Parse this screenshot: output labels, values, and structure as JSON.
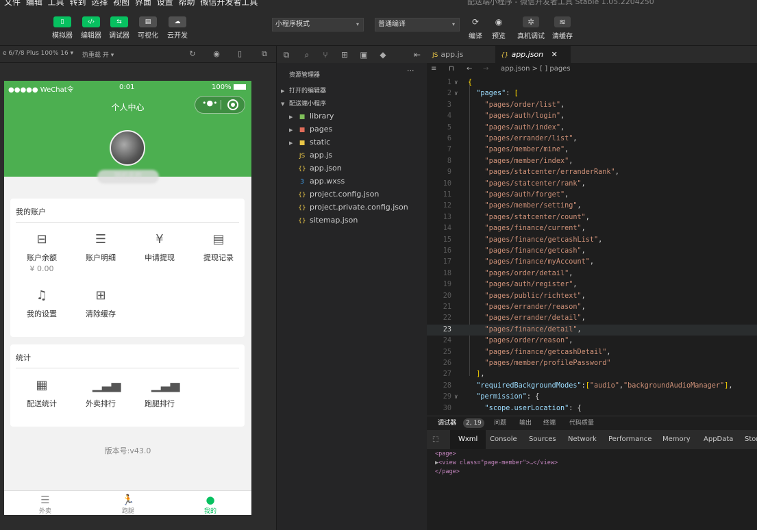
{
  "menubar": {
    "items": "文件 编辑 工具 转到 选择 视图 界面 设置 帮助 微信开发者工具",
    "window_title": "配送端小程序 - 微信开发者工具 Stable 1.05.2204250"
  },
  "toolbar": {
    "simulator": "模拟器",
    "editor": "编辑器",
    "debugger": "调试器",
    "visual": "可视化",
    "cloud": "云开发",
    "mode_select": "小程序模式",
    "compile_select": "普通编译",
    "compile": "编译",
    "preview": "预览",
    "real_debug": "真机调试",
    "clear_cache": "清缓存"
  },
  "simbar": {
    "device": "e 6/7/8 Plus 100% 16 ▾",
    "hotreload": "热重载 开 ▾"
  },
  "phone": {
    "carrier": "●●●●● WeChat令",
    "time": "0:01",
    "battery": "100%",
    "page_title": "个人中心",
    "username": "随机名称",
    "account_card": {
      "title": "我的账户",
      "items": [
        {
          "label": "账户余额",
          "value": "¥ 0.00",
          "icon": "wallet-icon"
        },
        {
          "label": "账户明细",
          "icon": "receipt-icon"
        },
        {
          "label": "申请提现",
          "icon": "withdraw-icon"
        },
        {
          "label": "提现记录",
          "icon": "record-icon"
        },
        {
          "label": "我的设置",
          "icon": "bell-icon"
        },
        {
          "label": "清除缓存",
          "icon": "trash-icon"
        }
      ]
    },
    "stats_card": {
      "title": "统计",
      "items": [
        {
          "label": "配送统计",
          "icon": "calendar-icon"
        },
        {
          "label": "外卖排行",
          "icon": "bar-chart-icon"
        },
        {
          "label": "跑腿排行",
          "icon": "bar-chart-icon"
        }
      ]
    },
    "version": "版本号:v43.0",
    "tabs": [
      {
        "label": "外卖"
      },
      {
        "label": "跑腿"
      },
      {
        "label": "我的"
      }
    ]
  },
  "explorer": {
    "title": "资源管理器",
    "sections": [
      "打开的编辑器",
      "配送端小程序"
    ],
    "folders": [
      "library",
      "pages",
      "static"
    ],
    "files": [
      "app.js",
      "app.json",
      "app.wxss",
      "project.config.json",
      "project.private.config.json",
      "sitemap.json"
    ]
  },
  "editor": {
    "tabs": [
      "app.js",
      "app.json"
    ],
    "breadcrumb": "app.json > [ ] pages",
    "pages": [
      "pages/order/list",
      "pages/auth/login",
      "pages/auth/index",
      "pages/errander/list",
      "pages/member/mine",
      "pages/member/index",
      "pages/statcenter/erranderRank",
      "pages/statcenter/rank",
      "pages/auth/forget",
      "pages/member/setting",
      "pages/statcenter/count",
      "pages/finance/current",
      "pages/finance/getcashList",
      "pages/finance/getcash",
      "pages/finance/myAccount",
      "pages/order/detail",
      "pages/auth/register",
      "pages/public/richtext",
      "pages/errander/reason",
      "pages/errander/detail",
      "pages/finance/detail",
      "pages/order/reason",
      "pages/finance/getcashDetail",
      "pages/member/profilePassword"
    ],
    "current_line": 23,
    "bg_modes_line": "\"requiredBackgroundModes\":[\"audio\",\"backgroundAudioManager\"],",
    "permission_line": "\"permission\": {",
    "scope_line": "\"scope.userLocation\": {"
  },
  "bottom": {
    "tabs": [
      "调试器",
      "2, 19",
      "问题",
      "输出",
      "终端",
      "代码质量"
    ],
    "devtools_tabs": [
      "Wxml",
      "Console",
      "Sources",
      "Network",
      "Performance",
      "Memory",
      "AppData",
      "Stor"
    ],
    "dom": [
      "<page>",
      "<view class=\"page-member\">…</view>",
      "</page>"
    ]
  }
}
